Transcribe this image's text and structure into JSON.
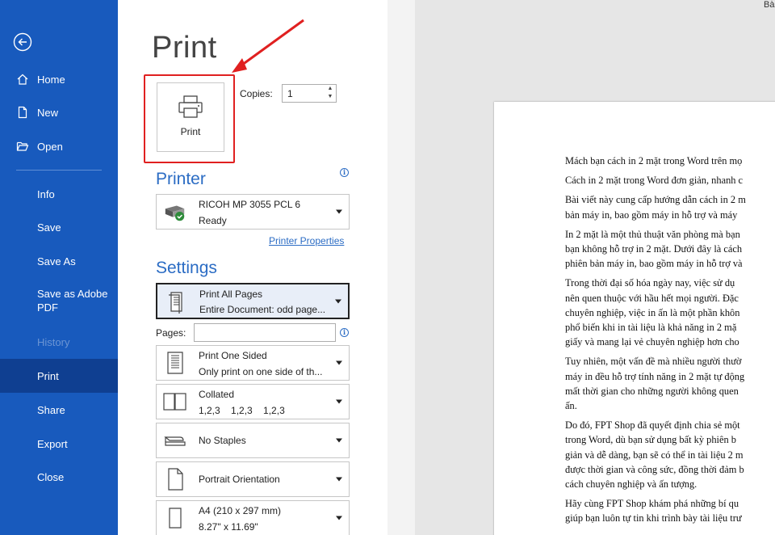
{
  "window": {
    "doc_title_partial": "Bà"
  },
  "nav": {
    "items": [
      {
        "label": "Home"
      },
      {
        "label": "New"
      },
      {
        "label": "Open"
      },
      {
        "label": "Info"
      },
      {
        "label": "Save"
      },
      {
        "label": "Save As"
      },
      {
        "label": "Save as Adobe PDF"
      },
      {
        "label": "History"
      },
      {
        "label": "Print"
      },
      {
        "label": "Share"
      },
      {
        "label": "Export"
      },
      {
        "label": "Close"
      }
    ],
    "active": "Print",
    "disabled": "History"
  },
  "print": {
    "title": "Print",
    "button_label": "Print",
    "copies_label": "Copies:",
    "copies_value": "1"
  },
  "printer": {
    "section_title": "Printer",
    "name": "RICOH MP 3055 PCL 6",
    "status": "Ready",
    "properties_link": "Printer Properties"
  },
  "settings": {
    "section_title": "Settings",
    "pages_label": "Pages:",
    "pages_value": "",
    "options": [
      {
        "line1": "Print All Pages",
        "line2": "Entire Document: odd page..."
      },
      {
        "line1": "Print One Sided",
        "line2": "Only print on one side of th..."
      },
      {
        "line1": "Collated",
        "line2": "1,2,3    1,2,3    1,2,3"
      },
      {
        "line1": "No Staples",
        "line2": ""
      },
      {
        "line1": "Portrait Orientation",
        "line2": ""
      },
      {
        "line1": "A4 (210 x 297 mm)",
        "line2": "8.27\" x 11.69\""
      }
    ]
  },
  "preview": {
    "paragraphs": [
      [
        "Mách bạn cách in 2 mặt trong Word trên mọ"
      ],
      [
        "Cách in 2 mặt trong Word đơn giản, nhanh c"
      ],
      [
        "Bài viết này cung cấp hướng dẫn cách in 2 m",
        "bản máy in, bao gồm máy in hỗ trợ và máy"
      ],
      [
        "In 2 mặt là một thủ thuật văn phòng mà bạn",
        "bạn không hỗ trợ in 2 mặt. Dưới đây là cách",
        "phiên bản máy in, bao gồm máy in hỗ trợ và"
      ],
      [
        "Trong thời đại số hóa ngày nay, việc sử dụ",
        "nên quen thuộc với hầu hết mọi người. Đặc",
        "chuyên nghiệp, việc in ấn là một phần khôn",
        "phổ biến khi in tài liệu là khả năng in 2 mặ",
        "giấy và mang lại vẻ chuyên nghiệp hơn cho"
      ],
      [
        "Tuy nhiên, một vấn đề mà nhiều người thườ",
        "máy in đều hỗ trợ tính năng in 2 mặt tự động",
        "mất thời gian cho những người không quen",
        "ấn."
      ],
      [
        "Do đó, FPT Shop đã quyết định chia sẻ một",
        "trong Word, dù bạn sử dụng bất kỳ phiên b",
        "giản và dễ dàng, bạn sẽ có thể in tài liệu 2 m",
        "được thời gian và công sức, đồng thời đảm b",
        "cách chuyên nghiệp và ấn tượng."
      ],
      [
        "Hãy cùng FPT Shop khám phá những bí qu",
        "giúp bạn luôn tự tin khi trình bày tài liệu trư"
      ]
    ]
  },
  "colors": {
    "nav_bg": "#185abd",
    "nav_active": "#0f3f91",
    "accent": "#2b6cc4",
    "highlight": "#e02020"
  }
}
